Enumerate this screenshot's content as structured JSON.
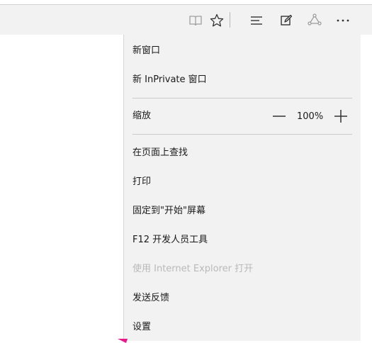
{
  "toolbar": {
    "icons": [
      "reading-view-icon",
      "favorite-star-icon",
      "hub-icon",
      "web-note-icon",
      "share-icon",
      "more-icon"
    ]
  },
  "menu": {
    "new_window": "新窗口",
    "new_inprivate": "新 InPrivate 窗口",
    "zoom_label": "缩放",
    "zoom_value": "100%",
    "find_on_page": "在页面上查找",
    "print": "打印",
    "pin_to_start": "固定到\"开始\"屏幕",
    "f12_tools": "F12 开发人员工具",
    "open_with_ie": "使用 Internet Explorer 打开",
    "send_feedback": "发送反馈",
    "settings": "设置"
  },
  "colors": {
    "toolbar_bg": "#f2f2f2",
    "menu_bg": "#f2f2f2",
    "disabled_text": "#b9b9b9",
    "accent_mark": "#e6198c"
  }
}
